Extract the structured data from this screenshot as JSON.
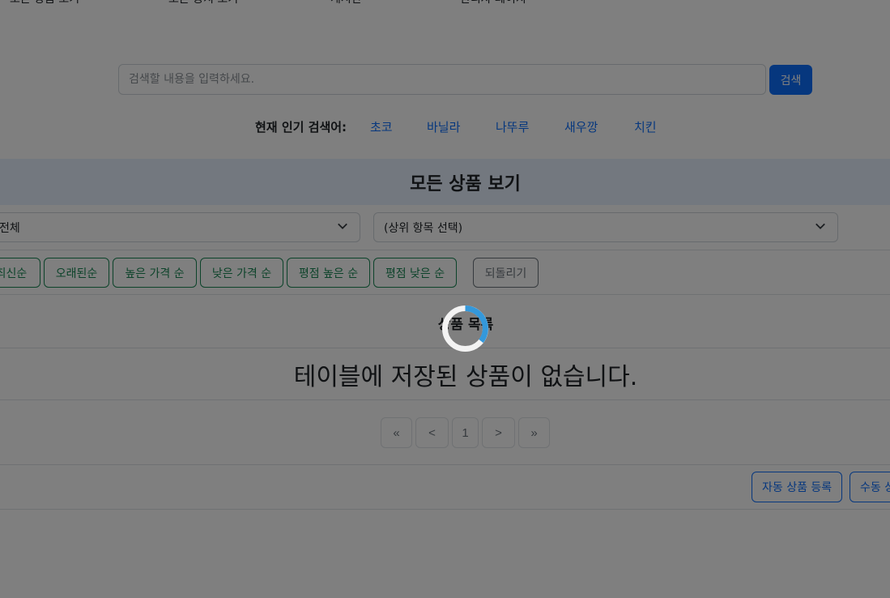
{
  "nav": {
    "items": [
      "모든 상품 보기",
      "모든 공지 보기",
      "게시판",
      "관리자 페이지"
    ]
  },
  "search": {
    "placeholder": "검색할 내용을 입력하세요.",
    "button_label": "검색"
  },
  "popular": {
    "label": "현재 인기 검색어:",
    "keywords": [
      "초코",
      "바닐라",
      "나뚜루",
      "새우깡",
      "치킨"
    ]
  },
  "section": {
    "title": "모든 상품 보기"
  },
  "filters": {
    "category_value": "전체",
    "sub_category_value": "(상위 항목 선택)"
  },
  "sort": {
    "buttons": [
      "최신순",
      "오래된순",
      "높은 가격 순",
      "낮은 가격 순",
      "평점 높은 순",
      "평점 낮은 순"
    ],
    "reset_label": "되돌리기"
  },
  "list": {
    "title": "상품 목록",
    "empty_message": "테이블에 저장된 상품이 없습니다."
  },
  "pagination": {
    "first": "«",
    "prev": "<",
    "current": "1",
    "next": ">",
    "last": "»"
  },
  "actions": {
    "auto_register": "자동 상품 등록",
    "manual_register": "수동 상품 등록"
  },
  "colors": {
    "primary": "#0d6efd",
    "success": "#198754",
    "header_bg": "#e7f1ff",
    "overlay": "rgba(0,0,0,0.5)",
    "spinner": "#3498db"
  }
}
